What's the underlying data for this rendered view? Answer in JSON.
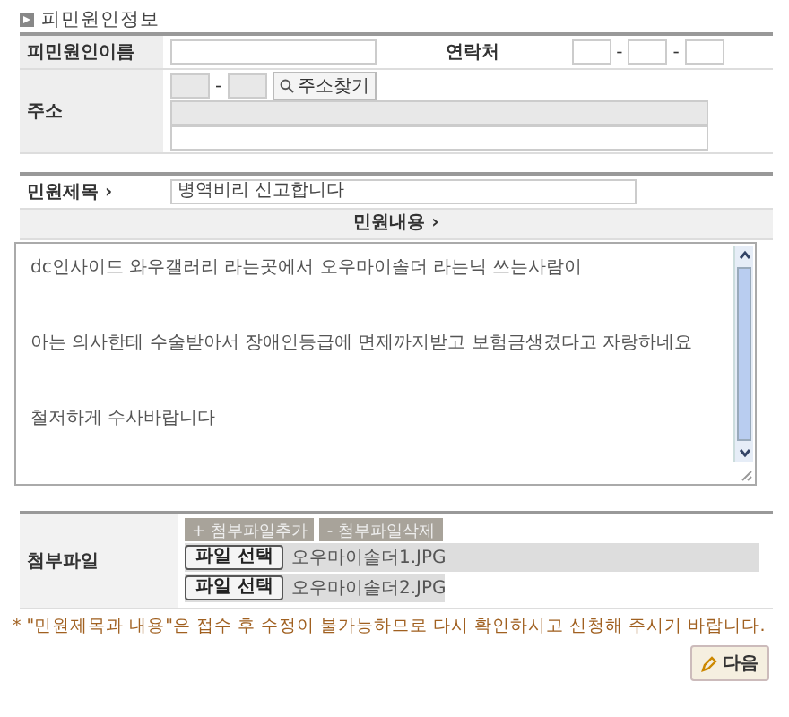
{
  "section_title": "피민원인정보",
  "respondent": {
    "name_label": "피민원인이름",
    "contact_label": "연락처",
    "phone_separators": [
      "-",
      "-"
    ],
    "address_label": "주소",
    "postal_separator": "-",
    "address_search_button": "주소찾기"
  },
  "complaint": {
    "title_label": "민원제목 ›",
    "title_value": "병역비리 신고합니다",
    "content_label": "민원내용 ›",
    "content_paragraphs": [
      "dc인사이드 와우갤러리 라는곳에서 오우마이솔더 라는닉 쓰는사람이",
      "아는 의사한테 수술받아서 장애인등급에 면제까지받고 보험금생겼다고 자랑하네요",
      "철저하게 수사바랍니다"
    ]
  },
  "attachments": {
    "label": "첨부파일",
    "add_button": "+ 첨부파일추가",
    "remove_button": "- 첨부파일삭제",
    "files": [
      {
        "button": "파일 선택",
        "filename": "오우마이솔더1.JPG"
      },
      {
        "button": "파일 선택",
        "filename": "오우마이솔더2.JPG"
      }
    ]
  },
  "notice": "* \"민원제목과 내용\"은 접수 후 수정이 불가능하므로 다시 확인하시고 신청해 주시기 바랍니다.",
  "next_button": "다음"
}
